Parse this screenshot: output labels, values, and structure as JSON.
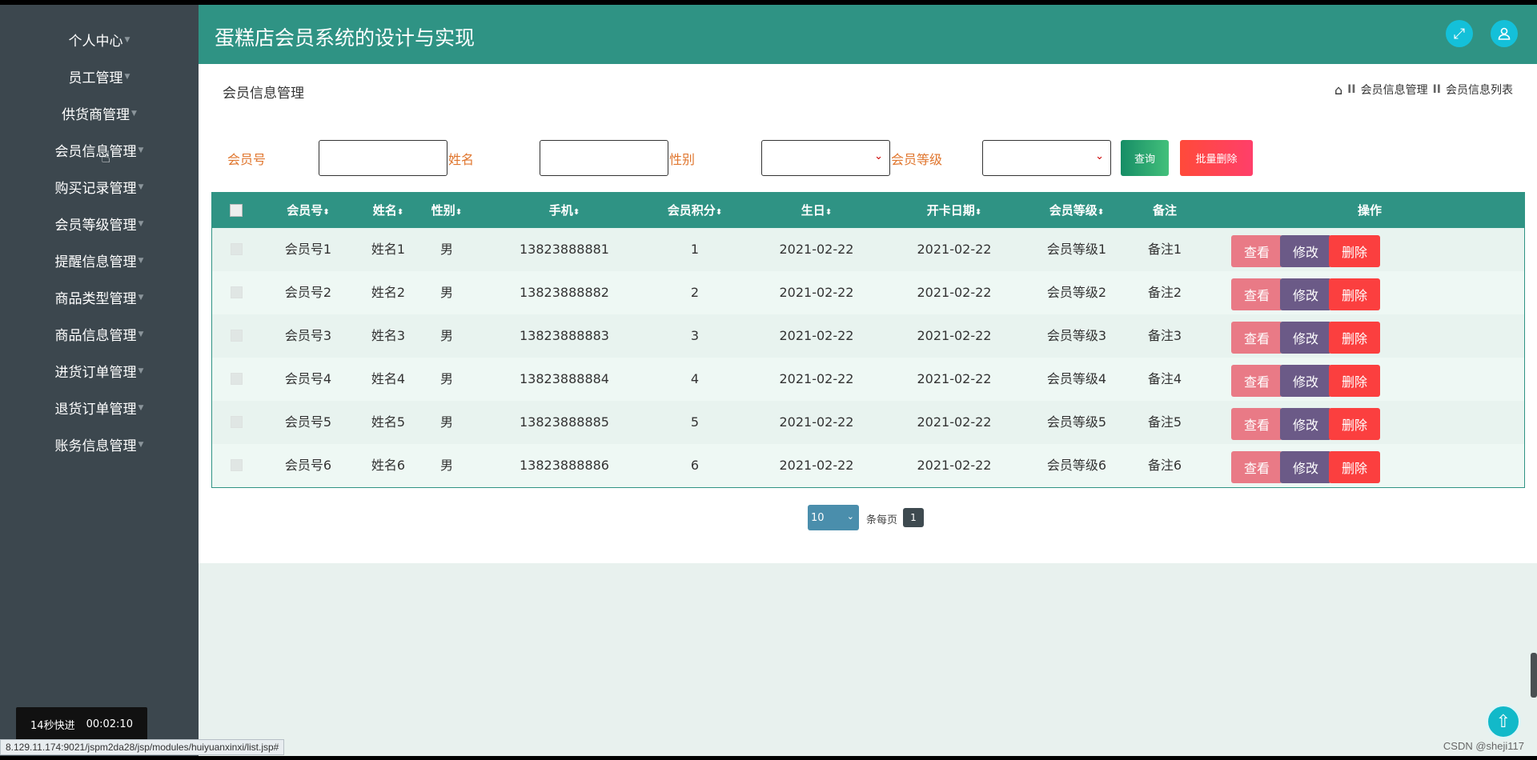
{
  "app": {
    "title": "蛋糕店会员系统的设计与实现"
  },
  "sidebar": {
    "items": [
      {
        "label": "个人中心"
      },
      {
        "label": "员工管理"
      },
      {
        "label": "供货商管理"
      },
      {
        "label": "会员信息管理"
      },
      {
        "label": "购买记录管理"
      },
      {
        "label": "会员等级管理"
      },
      {
        "label": "提醒信息管理"
      },
      {
        "label": "商品类型管理"
      },
      {
        "label": "商品信息管理"
      },
      {
        "label": "进货订单管理"
      },
      {
        "label": "退货订单管理"
      },
      {
        "label": "账务信息管理"
      }
    ]
  },
  "header": {
    "fullscreen_icon": "expand-icon",
    "user_icon": "user-icon"
  },
  "page": {
    "heading": "会员信息管理",
    "breadcrumb": {
      "home_icon": "home-icon",
      "sep": "II",
      "level1": "会员信息管理",
      "level2": "会员信息列表"
    }
  },
  "search": {
    "member_no_label": "会员号",
    "name_label": "姓名",
    "gender_label": "性别",
    "level_label": "会员等级",
    "query_button": "查询",
    "batch_delete_button": "批量删除"
  },
  "table": {
    "headers": [
      "会员号",
      "姓名",
      "性别",
      "手机",
      "会员积分",
      "生日",
      "开卡日期",
      "会员等级",
      "备注",
      "操作"
    ],
    "sort_glyph": "⬍",
    "actions": {
      "view": "查看",
      "edit": "修改",
      "delete": "删除"
    },
    "rows": [
      {
        "member_no": "会员号1",
        "name": "姓名1",
        "gender": "男",
        "phone": "13823888881",
        "points": "1",
        "birthday": "2021-02-22",
        "card_date": "2021-02-22",
        "level": "会员等级1",
        "note": "备注1"
      },
      {
        "member_no": "会员号2",
        "name": "姓名2",
        "gender": "男",
        "phone": "13823888882",
        "points": "2",
        "birthday": "2021-02-22",
        "card_date": "2021-02-22",
        "level": "会员等级2",
        "note": "备注2"
      },
      {
        "member_no": "会员号3",
        "name": "姓名3",
        "gender": "男",
        "phone": "13823888883",
        "points": "3",
        "birthday": "2021-02-22",
        "card_date": "2021-02-22",
        "level": "会员等级3",
        "note": "备注3"
      },
      {
        "member_no": "会员号4",
        "name": "姓名4",
        "gender": "男",
        "phone": "13823888884",
        "points": "4",
        "birthday": "2021-02-22",
        "card_date": "2021-02-22",
        "level": "会员等级4",
        "note": "备注4"
      },
      {
        "member_no": "会员号5",
        "name": "姓名5",
        "gender": "男",
        "phone": "13823888885",
        "points": "5",
        "birthday": "2021-02-22",
        "card_date": "2021-02-22",
        "level": "会员等级5",
        "note": "备注5"
      },
      {
        "member_no": "会员号6",
        "name": "姓名6",
        "gender": "男",
        "phone": "13823888886",
        "points": "6",
        "birthday": "2021-02-22",
        "card_date": "2021-02-22",
        "level": "会员等级6",
        "note": "备注6"
      }
    ]
  },
  "pagination": {
    "page_size": "10",
    "per_page_label": "条每页",
    "current_page": "1"
  },
  "overlay": {
    "video_label": "14秒快进",
    "video_time": "00:02:10",
    "status_url": "8.129.11.174:9021/jspm2da28/jsp/modules/huiyuanxinxi/list.jsp#",
    "watermark": "CSDN @sheji117"
  },
  "colors": {
    "header": "#2f9384",
    "sidebar": "#3c474e",
    "label": "#e0762e"
  }
}
